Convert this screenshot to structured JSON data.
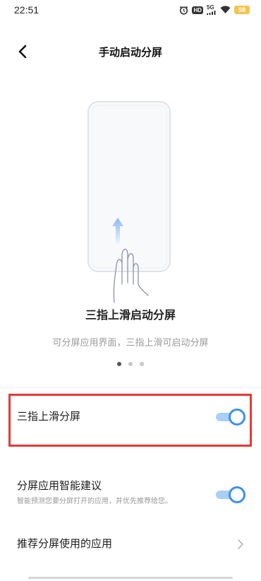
{
  "status_bar": {
    "time": "22:51",
    "hd_label": "HD",
    "signal_label": "5G",
    "battery_level": "58"
  },
  "header": {
    "title": "手动启动分屏",
    "back_icon": "chevron-left-icon"
  },
  "illustration": {
    "caption": "三指上滑启动分屏",
    "subtitle": "可分屏应用界面，三指上滑可启动分屏",
    "pages_total": 3,
    "page_active": 1
  },
  "settings": {
    "three_finger_swipe": {
      "label": "三指上滑分屏",
      "enabled": true
    },
    "smart_suggestion": {
      "label": "分屏应用智能建议",
      "description": "智能预测您要分屏打开的应用，并优先推荐给您。",
      "enabled": true
    },
    "recommended_apps": {
      "label": "推荐分屏使用的应用"
    }
  },
  "colors": {
    "accent": "#3d8ff0",
    "toggle_track": "#a8d0f7",
    "highlight": "#e53935",
    "battery": "#f6c44a"
  }
}
